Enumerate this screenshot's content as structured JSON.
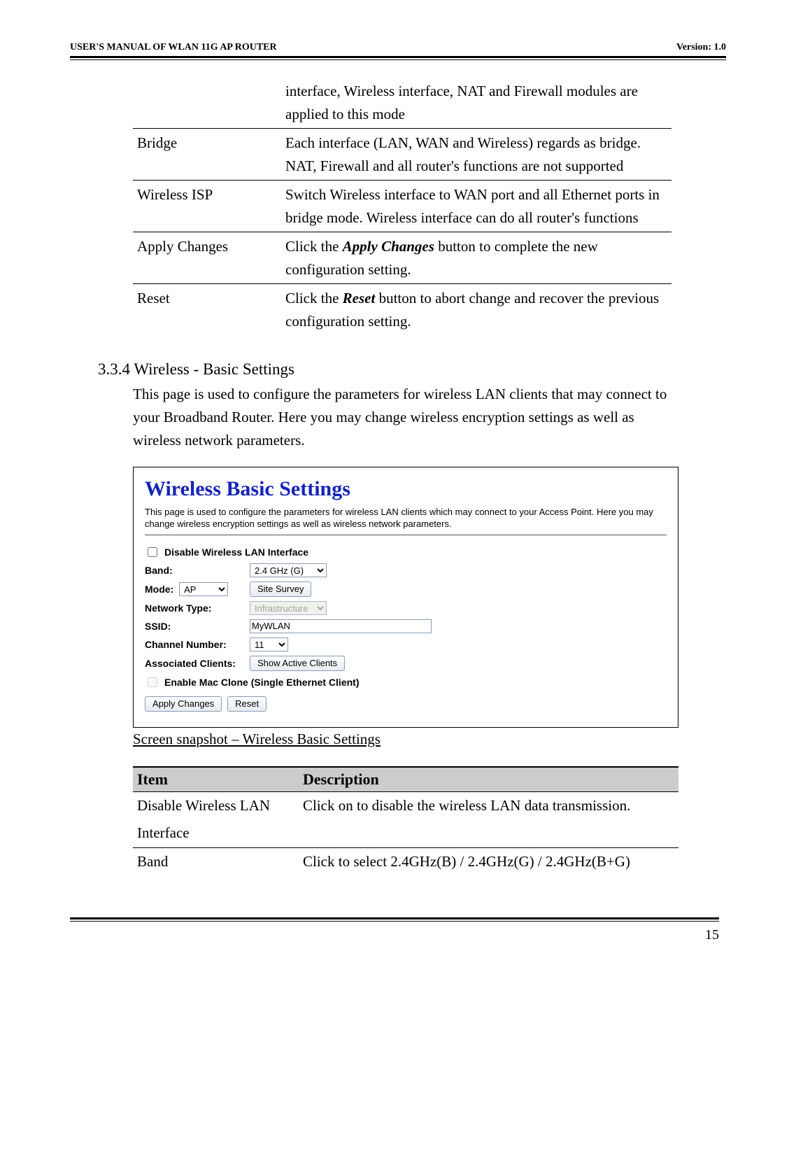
{
  "header": {
    "left": "USER'S MANUAL OF WLAN 11G AP ROUTER",
    "right": "Version: 1.0"
  },
  "top_table": {
    "row0_desc": "interface, Wireless interface, NAT and Firewall modules are applied to this mode",
    "rows": [
      {
        "item": "Bridge",
        "desc": "Each interface (LAN, WAN and Wireless) regards as bridge. NAT, Firewall and all router's functions are not supported"
      },
      {
        "item": "Wireless ISP",
        "desc": "Switch Wireless interface to WAN port and all Ethernet ports in bridge mode. Wireless interface can do all router's functions"
      },
      {
        "item": "Apply Changes",
        "desc_pre": "Click the ",
        "desc_em": "Apply Changes",
        "desc_post": " button to complete the new configuration setting."
      },
      {
        "item": "Reset",
        "desc_pre": "Click the ",
        "desc_em": "Reset",
        "desc_post": " button to abort change and recover the previous configuration setting."
      }
    ]
  },
  "section": {
    "heading": "3.3.4  Wireless - Basic Settings",
    "body": "This page is used to configure the parameters for wireless LAN clients that may connect to your Broadband Router. Here you may change wireless encryption settings as well as wireless network parameters."
  },
  "wbs": {
    "title": "Wireless Basic Settings",
    "desc": "This page is used to configure the parameters for wireless LAN clients which may connect to your Access Point. Here you may change wireless encryption settings as well as wireless network parameters.",
    "disable_label": "Disable Wireless LAN Interface",
    "band_label": "Band:",
    "band_value": "2.4 GHz (G)",
    "mode_label": "Mode:",
    "mode_value": "AP",
    "site_survey": "Site Survey",
    "nettype_label": "Network Type:",
    "nettype_value": "Infrastructure",
    "ssid_label": "SSID:",
    "ssid_value": "MyWLAN",
    "chan_label": "Channel Number:",
    "chan_value": "11",
    "assoc_label": "Associated Clients:",
    "show_clients": "Show Active Clients",
    "mac_clone_label": "Enable Mac Clone (Single Ethernet Client)",
    "apply": "Apply Changes",
    "reset": "Reset"
  },
  "caption": "Screen snapshot – Wireless Basic Settings",
  "desc_table": {
    "h1": "Item",
    "h2": "Description",
    "rows": [
      {
        "item1": "Disable Wireless LAN",
        "item2": "Interface",
        "desc": "Click on to disable the wireless LAN data transmission."
      },
      {
        "item1": "Band",
        "desc": "Click to select 2.4GHz(B) / 2.4GHz(G) / 2.4GHz(B+G)"
      }
    ]
  },
  "page_num": "15"
}
